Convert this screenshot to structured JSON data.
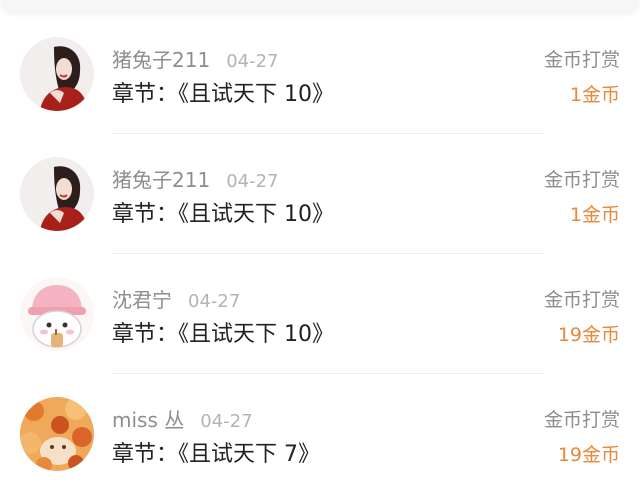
{
  "records": [
    {
      "username": "猪兔子211",
      "date": "04-27",
      "chapter": "章节：《且试天下 10》",
      "gift_type": "金币打赏",
      "amount": "1金币",
      "avatar_icon": "portrait-woman-red-avatar"
    },
    {
      "username": "猪兔子211",
      "date": "04-27",
      "chapter": "章节：《且试天下 10》",
      "gift_type": "金币打赏",
      "amount": "1金币",
      "avatar_icon": "portrait-woman-red-avatar"
    },
    {
      "username": "沈君宁",
      "date": "04-27",
      "chapter": "章节：《且试天下 10》",
      "gift_type": "金币打赏",
      "amount": "19金币",
      "avatar_icon": "cartoon-bunny-pink-hat-avatar"
    },
    {
      "username": "miss 丛",
      "date": "04-27",
      "chapter": "章节：《且试天下 7》",
      "gift_type": "金币打赏",
      "amount": "19金币",
      "avatar_icon": "autumn-leaves-avatar"
    }
  ],
  "colors": {
    "amount": "#e8883a",
    "meta": "#8e8e8e",
    "date": "#b4b4b4",
    "text": "#222222"
  }
}
